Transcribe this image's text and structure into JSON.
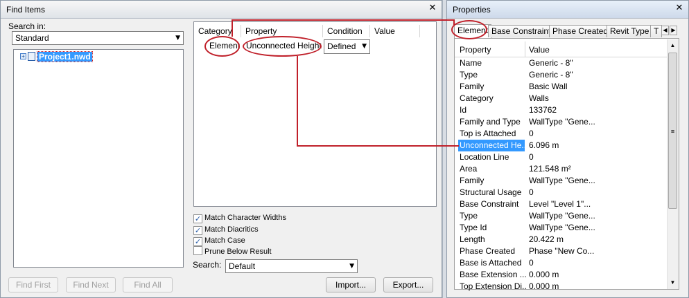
{
  "find_items": {
    "title": "Find Items",
    "search_in_label": "Search in:",
    "search_in_value": "Standard",
    "tree_item": "Project1.nwd",
    "grid_headers": [
      "Category",
      "Property",
      "Condition",
      "Value"
    ],
    "row": {
      "category": "Element",
      "property": "Unconnected Height",
      "condition": "Defined",
      "value": ""
    },
    "options": [
      {
        "label": "Match Character Widths",
        "checked": true
      },
      {
        "label": "Match Diacritics",
        "checked": true
      },
      {
        "label": "Match Case",
        "checked": true
      },
      {
        "label": "Prune Below Result",
        "checked": false
      }
    ],
    "search_label": "Search:",
    "search_value": "Default",
    "buttons": {
      "find_first": "Find First",
      "find_next": "Find Next",
      "find_all": "Find All",
      "import": "Import...",
      "export": "Export..."
    }
  },
  "properties": {
    "title": "Properties",
    "tabs": [
      "Element",
      "Base Constraint",
      "Phase Created",
      "Revit Type",
      "T"
    ],
    "headers": {
      "property": "Property",
      "value": "Value"
    },
    "rows": [
      {
        "k": "Name",
        "v": "Generic - 8\""
      },
      {
        "k": "Type",
        "v": "Generic - 8\""
      },
      {
        "k": "Family",
        "v": "Basic Wall"
      },
      {
        "k": "Category",
        "v": "Walls"
      },
      {
        "k": "Id",
        "v": "133762"
      },
      {
        "k": "Family and Type",
        "v": "WallType \"Gene..."
      },
      {
        "k": "Top is Attached",
        "v": "0"
      },
      {
        "k": "Unconnected He...",
        "v": "6.096 m"
      },
      {
        "k": "Location Line",
        "v": "0"
      },
      {
        "k": "Area",
        "v": "121.548 m²"
      },
      {
        "k": "Family",
        "v": "WallType \"Gene..."
      },
      {
        "k": "Structural Usage",
        "v": "0"
      },
      {
        "k": "Base Constraint",
        "v": "Level \"Level 1\"..."
      },
      {
        "k": "Type",
        "v": "WallType \"Gene..."
      },
      {
        "k": "Type Id",
        "v": "WallType \"Gene..."
      },
      {
        "k": "Length",
        "v": "20.422 m"
      },
      {
        "k": "Phase Created",
        "v": "Phase \"New Co..."
      },
      {
        "k": "Base is Attached",
        "v": "0"
      },
      {
        "k": "Base Extension ...",
        "v": "0.000 m"
      },
      {
        "k": "Top Extension Di...",
        "v": "0.000 m"
      }
    ],
    "selected_row": 7
  }
}
